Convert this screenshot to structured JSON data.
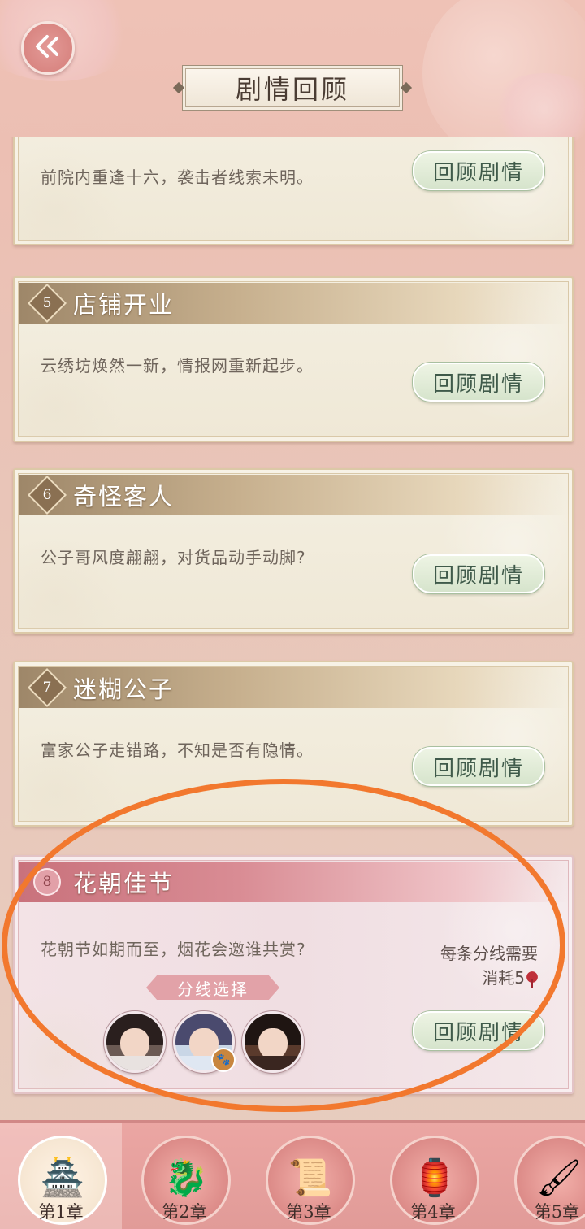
{
  "header": {
    "title": "剧情回顾",
    "back_icon": "back-arrow-icon"
  },
  "cards": [
    {
      "number": "",
      "title": "",
      "desc": "前院内重逢十六，袭击者线索未明。",
      "button": "回顾剧情"
    },
    {
      "number": "5",
      "title": "店铺开业",
      "desc": "云绣坊焕然一新，情报网重新起步。",
      "button": "回顾剧情"
    },
    {
      "number": "6",
      "title": "奇怪客人",
      "desc": "公子哥风度翩翩，对货品动手动脚?",
      "button": "回顾剧情"
    },
    {
      "number": "7",
      "title": "迷糊公子",
      "desc": "富家公子走错路，不知是否有隐情。",
      "button": "回顾剧情"
    }
  ],
  "featured": {
    "number": "8",
    "title": "花朝佳节",
    "desc": "花朝节如期而至，烟花会邀谁共赏?",
    "branch_label": "分线选择",
    "cost_line1": "每条分线需要",
    "cost_line2": "消耗5",
    "button": "回顾剧情"
  },
  "tabs": [
    {
      "label": "第1章",
      "icon": "pavilion-icon",
      "active": true
    },
    {
      "label": "第2章",
      "icon": "jade-dragon-icon",
      "active": false
    },
    {
      "label": "第3章",
      "icon": "book-icon",
      "active": false
    },
    {
      "label": "第4章",
      "icon": "lantern-icon",
      "active": false
    },
    {
      "label": "第5章",
      "icon": "brush-icon",
      "active": false
    }
  ],
  "colors": {
    "accent_pink": "#d98682",
    "button_green": "#d6e4cc",
    "annotation_orange": "#f2782e"
  }
}
